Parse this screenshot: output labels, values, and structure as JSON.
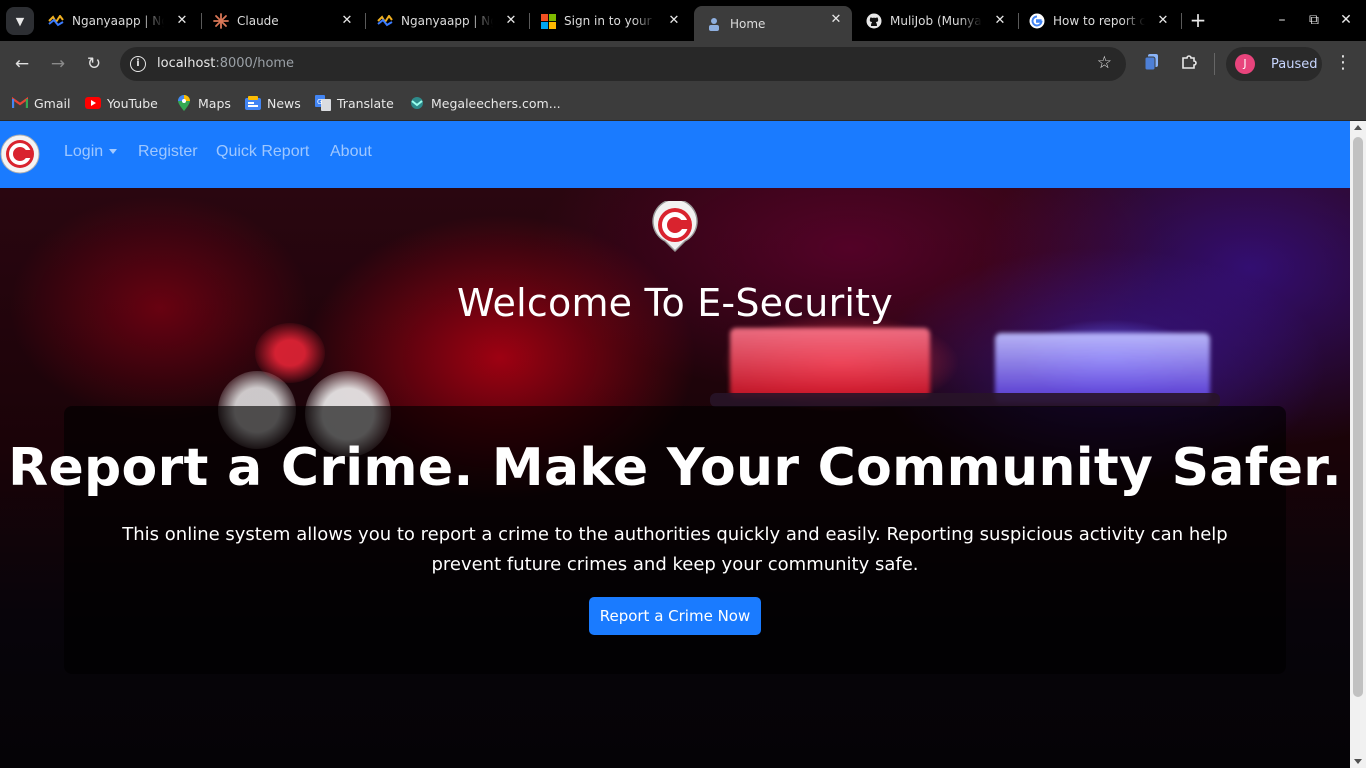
{
  "browser": {
    "tabs": [
      {
        "title": "Nganyaapp | Nganyaapp",
        "icon": "nganya-favicon-icon",
        "active": false
      },
      {
        "title": "Claude",
        "icon": "claude-favicon-icon",
        "active": false
      },
      {
        "title": "Nganyaapp | Nganyaapp",
        "icon": "nganya-favicon-icon",
        "active": false
      },
      {
        "title": "Sign in to your account",
        "icon": "microsoft-favicon-icon",
        "active": false
      },
      {
        "title": "Home",
        "icon": "page-favicon-icon",
        "active": true
      },
      {
        "title": "MuliJob (Munyao)",
        "icon": "github-favicon-icon",
        "active": false
      },
      {
        "title": "How to report crime",
        "icon": "google-favicon-icon",
        "active": false
      }
    ],
    "address": {
      "host": "localhost",
      "path": ":8000/home"
    },
    "profile_label": "Paused",
    "profile_initial": "J",
    "bookmarks": [
      {
        "label": "Gmail",
        "icon": "gmail-icon"
      },
      {
        "label": "YouTube",
        "icon": "youtube-icon"
      },
      {
        "label": "Maps",
        "icon": "maps-icon"
      },
      {
        "label": "News",
        "icon": "news-icon"
      },
      {
        "label": "Translate",
        "icon": "translate-icon"
      },
      {
        "label": "Megaleechers.com...",
        "icon": "megaleechers-icon"
      }
    ]
  },
  "navbar": {
    "links": [
      {
        "label": "Login",
        "dropdown": true
      },
      {
        "label": "Register"
      },
      {
        "label": "Quick Report"
      },
      {
        "label": "About"
      }
    ],
    "brand_color": "#1a7bff"
  },
  "hero": {
    "heading": "Welcome To E-Security",
    "title": "Report a Crime. Make Your Community Safer.",
    "description": "This online system allows you to report a crime to the authorities quickly and easily. Reporting suspicious activity can help prevent future crimes and keep your community safe.",
    "cta_label": "Report a Crime Now"
  },
  "colors": {
    "accent": "#1a7bff",
    "logo_red": "#d9232e"
  }
}
